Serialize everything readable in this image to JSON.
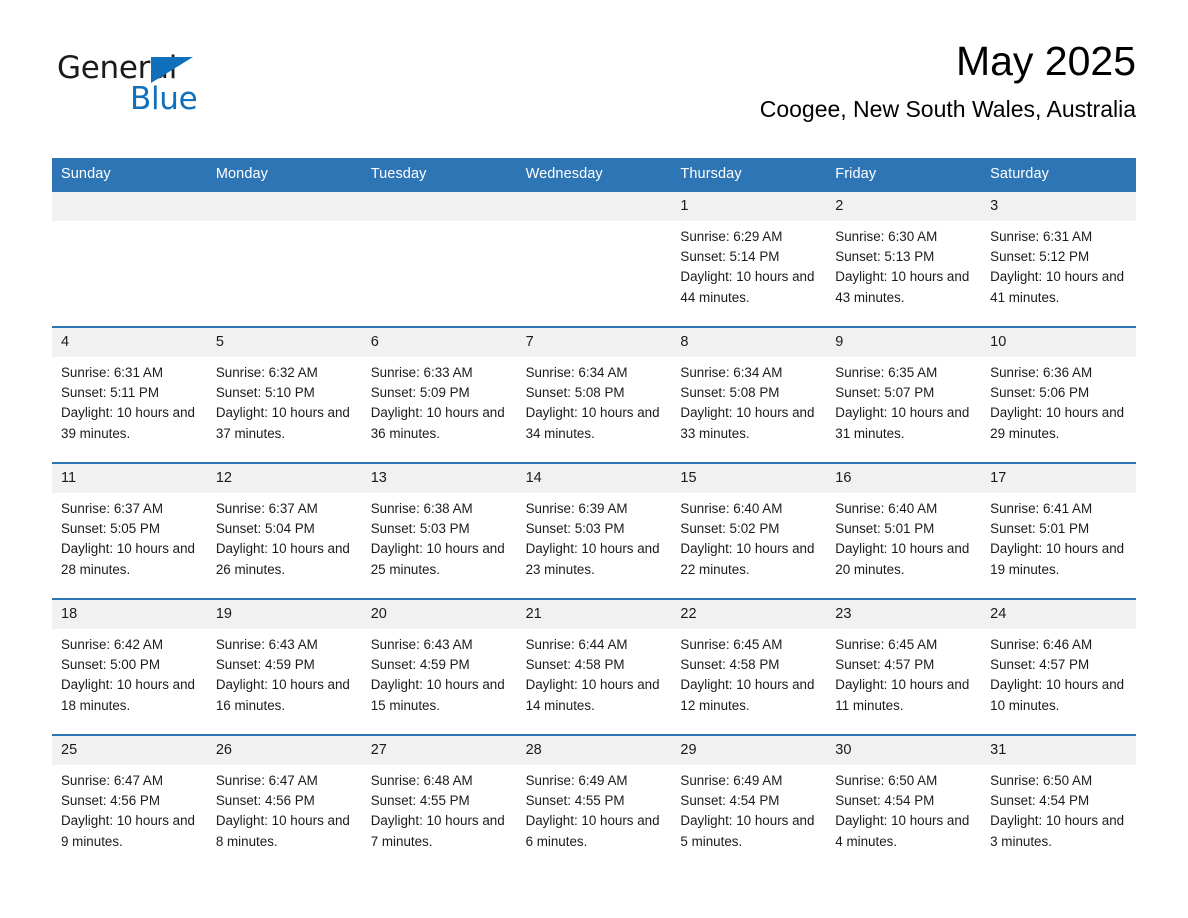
{
  "brand": {
    "name_dark": "General",
    "name_light": "Blue",
    "accent_color": "#1170bb"
  },
  "header": {
    "title": "May 2025",
    "subtitle": "Coogee, New South Wales, Australia"
  },
  "theme": {
    "header_blue": "#2e75b6",
    "date_band_gray": "#f1f1f1",
    "text_color": "#1b1b1b"
  },
  "weekdays": [
    "Sunday",
    "Monday",
    "Tuesday",
    "Wednesday",
    "Thursday",
    "Friday",
    "Saturday"
  ],
  "weeks": [
    [
      {
        "date": "",
        "sunrise": "",
        "sunset": "",
        "daylight": ""
      },
      {
        "date": "",
        "sunrise": "",
        "sunset": "",
        "daylight": ""
      },
      {
        "date": "",
        "sunrise": "",
        "sunset": "",
        "daylight": ""
      },
      {
        "date": "",
        "sunrise": "",
        "sunset": "",
        "daylight": ""
      },
      {
        "date": "1",
        "sunrise": "Sunrise: 6:29 AM",
        "sunset": "Sunset: 5:14 PM",
        "daylight": "Daylight: 10 hours and 44 minutes."
      },
      {
        "date": "2",
        "sunrise": "Sunrise: 6:30 AM",
        "sunset": "Sunset: 5:13 PM",
        "daylight": "Daylight: 10 hours and 43 minutes."
      },
      {
        "date": "3",
        "sunrise": "Sunrise: 6:31 AM",
        "sunset": "Sunset: 5:12 PM",
        "daylight": "Daylight: 10 hours and 41 minutes."
      }
    ],
    [
      {
        "date": "4",
        "sunrise": "Sunrise: 6:31 AM",
        "sunset": "Sunset: 5:11 PM",
        "daylight": "Daylight: 10 hours and 39 minutes."
      },
      {
        "date": "5",
        "sunrise": "Sunrise: 6:32 AM",
        "sunset": "Sunset: 5:10 PM",
        "daylight": "Daylight: 10 hours and 37 minutes."
      },
      {
        "date": "6",
        "sunrise": "Sunrise: 6:33 AM",
        "sunset": "Sunset: 5:09 PM",
        "daylight": "Daylight: 10 hours and 36 minutes."
      },
      {
        "date": "7",
        "sunrise": "Sunrise: 6:34 AM",
        "sunset": "Sunset: 5:08 PM",
        "daylight": "Daylight: 10 hours and 34 minutes."
      },
      {
        "date": "8",
        "sunrise": "Sunrise: 6:34 AM",
        "sunset": "Sunset: 5:08 PM",
        "daylight": "Daylight: 10 hours and 33 minutes."
      },
      {
        "date": "9",
        "sunrise": "Sunrise: 6:35 AM",
        "sunset": "Sunset: 5:07 PM",
        "daylight": "Daylight: 10 hours and 31 minutes."
      },
      {
        "date": "10",
        "sunrise": "Sunrise: 6:36 AM",
        "sunset": "Sunset: 5:06 PM",
        "daylight": "Daylight: 10 hours and 29 minutes."
      }
    ],
    [
      {
        "date": "11",
        "sunrise": "Sunrise: 6:37 AM",
        "sunset": "Sunset: 5:05 PM",
        "daylight": "Daylight: 10 hours and 28 minutes."
      },
      {
        "date": "12",
        "sunrise": "Sunrise: 6:37 AM",
        "sunset": "Sunset: 5:04 PM",
        "daylight": "Daylight: 10 hours and 26 minutes."
      },
      {
        "date": "13",
        "sunrise": "Sunrise: 6:38 AM",
        "sunset": "Sunset: 5:03 PM",
        "daylight": "Daylight: 10 hours and 25 minutes."
      },
      {
        "date": "14",
        "sunrise": "Sunrise: 6:39 AM",
        "sunset": "Sunset: 5:03 PM",
        "daylight": "Daylight: 10 hours and 23 minutes."
      },
      {
        "date": "15",
        "sunrise": "Sunrise: 6:40 AM",
        "sunset": "Sunset: 5:02 PM",
        "daylight": "Daylight: 10 hours and 22 minutes."
      },
      {
        "date": "16",
        "sunrise": "Sunrise: 6:40 AM",
        "sunset": "Sunset: 5:01 PM",
        "daylight": "Daylight: 10 hours and 20 minutes."
      },
      {
        "date": "17",
        "sunrise": "Sunrise: 6:41 AM",
        "sunset": "Sunset: 5:01 PM",
        "daylight": "Daylight: 10 hours and 19 minutes."
      }
    ],
    [
      {
        "date": "18",
        "sunrise": "Sunrise: 6:42 AM",
        "sunset": "Sunset: 5:00 PM",
        "daylight": "Daylight: 10 hours and 18 minutes."
      },
      {
        "date": "19",
        "sunrise": "Sunrise: 6:43 AM",
        "sunset": "Sunset: 4:59 PM",
        "daylight": "Daylight: 10 hours and 16 minutes."
      },
      {
        "date": "20",
        "sunrise": "Sunrise: 6:43 AM",
        "sunset": "Sunset: 4:59 PM",
        "daylight": "Daylight: 10 hours and 15 minutes."
      },
      {
        "date": "21",
        "sunrise": "Sunrise: 6:44 AM",
        "sunset": "Sunset: 4:58 PM",
        "daylight": "Daylight: 10 hours and 14 minutes."
      },
      {
        "date": "22",
        "sunrise": "Sunrise: 6:45 AM",
        "sunset": "Sunset: 4:58 PM",
        "daylight": "Daylight: 10 hours and 12 minutes."
      },
      {
        "date": "23",
        "sunrise": "Sunrise: 6:45 AM",
        "sunset": "Sunset: 4:57 PM",
        "daylight": "Daylight: 10 hours and 11 minutes."
      },
      {
        "date": "24",
        "sunrise": "Sunrise: 6:46 AM",
        "sunset": "Sunset: 4:57 PM",
        "daylight": "Daylight: 10 hours and 10 minutes."
      }
    ],
    [
      {
        "date": "25",
        "sunrise": "Sunrise: 6:47 AM",
        "sunset": "Sunset: 4:56 PM",
        "daylight": "Daylight: 10 hours and 9 minutes."
      },
      {
        "date": "26",
        "sunrise": "Sunrise: 6:47 AM",
        "sunset": "Sunset: 4:56 PM",
        "daylight": "Daylight: 10 hours and 8 minutes."
      },
      {
        "date": "27",
        "sunrise": "Sunrise: 6:48 AM",
        "sunset": "Sunset: 4:55 PM",
        "daylight": "Daylight: 10 hours and 7 minutes."
      },
      {
        "date": "28",
        "sunrise": "Sunrise: 6:49 AM",
        "sunset": "Sunset: 4:55 PM",
        "daylight": "Daylight: 10 hours and 6 minutes."
      },
      {
        "date": "29",
        "sunrise": "Sunrise: 6:49 AM",
        "sunset": "Sunset: 4:54 PM",
        "daylight": "Daylight: 10 hours and 5 minutes."
      },
      {
        "date": "30",
        "sunrise": "Sunrise: 6:50 AM",
        "sunset": "Sunset: 4:54 PM",
        "daylight": "Daylight: 10 hours and 4 minutes."
      },
      {
        "date": "31",
        "sunrise": "Sunrise: 6:50 AM",
        "sunset": "Sunset: 4:54 PM",
        "daylight": "Daylight: 10 hours and 3 minutes."
      }
    ]
  ]
}
